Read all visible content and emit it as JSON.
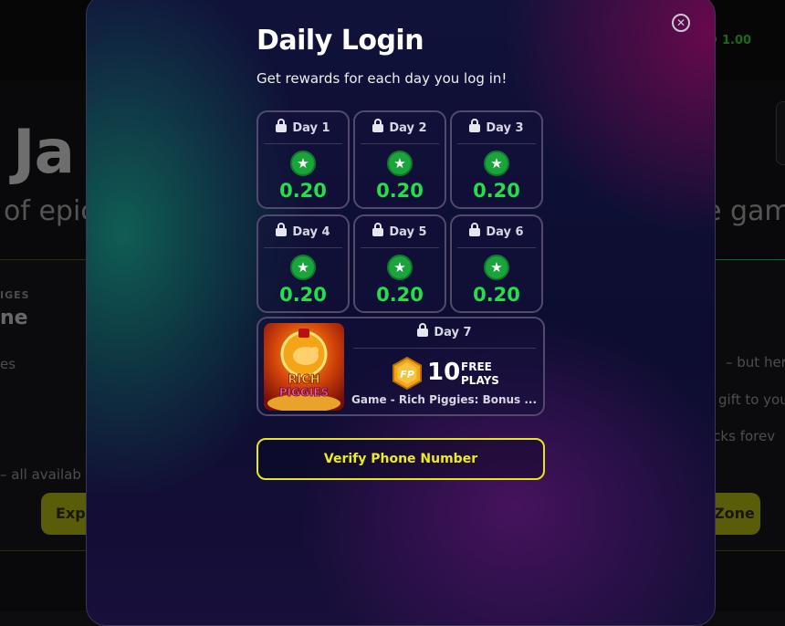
{
  "background": {
    "balance": "1.00",
    "hero_title": "Ja",
    "hero_sub_left": "of epic",
    "hero_sub_right": "e gam",
    "card_label": "IGES",
    "card_title": "ne",
    "left_lines": [
      "es",
      "– all availab"
    ],
    "right_lines": [
      "– but here",
      "gift to you",
      "ocks forev"
    ],
    "explore_button": "Expl",
    "zone_button": "Zone"
  },
  "modal": {
    "title": "Daily Login",
    "subtitle": "Get rewards for each day you log in!",
    "close_icon": "close-icon",
    "days": [
      {
        "label": "Day 1",
        "amount": "0.20"
      },
      {
        "label": "Day 2",
        "amount": "0.20"
      },
      {
        "label": "Day 3",
        "amount": "0.20"
      },
      {
        "label": "Day 4",
        "amount": "0.20"
      },
      {
        "label": "Day 5",
        "amount": "0.20"
      },
      {
        "label": "Day 6",
        "amount": "0.20"
      }
    ],
    "day7": {
      "label": "Day 7",
      "count": "10",
      "unit_line1": "FREE",
      "unit_line2": "PLAYS",
      "badge": "FP",
      "game": "Game - Rich Piggies: Bonus ...",
      "thumb_line1": "RICH",
      "thumb_line2": "PIGGIES"
    },
    "verify_button": "Verify Phone Number"
  },
  "colors": {
    "reward_green": "#21e04a",
    "accent_yellow": "#ecec1c"
  }
}
